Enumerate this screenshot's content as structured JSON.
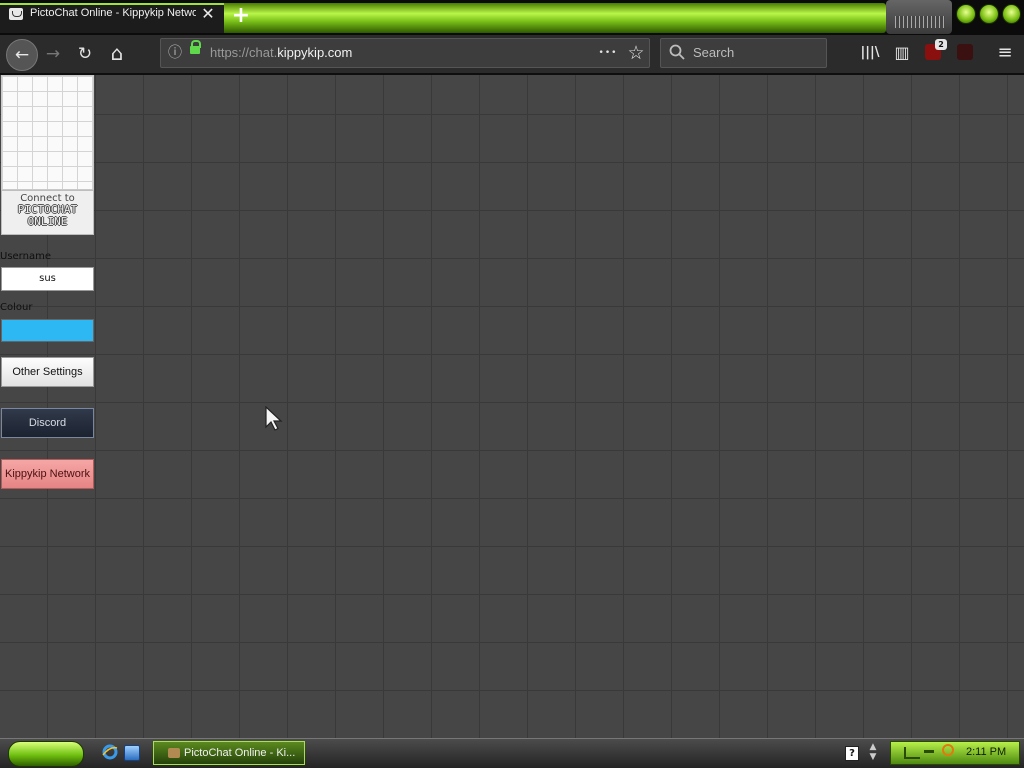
{
  "browser": {
    "tab": {
      "title": "PictoChat Online - Kippykip Network",
      "close_glyph": "✕"
    },
    "new_tab_glyph": "+",
    "nav": {
      "back_glyph": "←",
      "forward_glyph": "→",
      "reload_glyph": "↻",
      "home_glyph": "⌂",
      "info_glyph": "ⓘ",
      "more_glyph": "•••",
      "bookmark_glyph": "☆",
      "library_glyph": "|||\\",
      "sidebar_glyph": "▥",
      "menu_glyph": "≡"
    },
    "url": {
      "prefix": "https://chat.",
      "domain": "kippykip.com"
    },
    "search": {
      "placeholder": "Search",
      "icon": "search-icon"
    },
    "extensions": {
      "ublock_badge": "2"
    },
    "accent_color": "#8ee02a"
  },
  "sidebar": {
    "connect": {
      "line1": "Connect to",
      "logo_line1": "PICTOCHAT",
      "logo_line2": "ONLINE"
    },
    "username_label": "Username",
    "username_value": "sus",
    "colour_label": "Colour",
    "colour_value": "#2db8f3",
    "buttons": {
      "other_settings": "Other Settings",
      "discord": "Discord",
      "kippykip": "Kippykip Network"
    }
  },
  "taskbar": {
    "task_item": "PictoChat Online - Ki...",
    "help_glyph": "?",
    "clock": "2:11 PM"
  }
}
